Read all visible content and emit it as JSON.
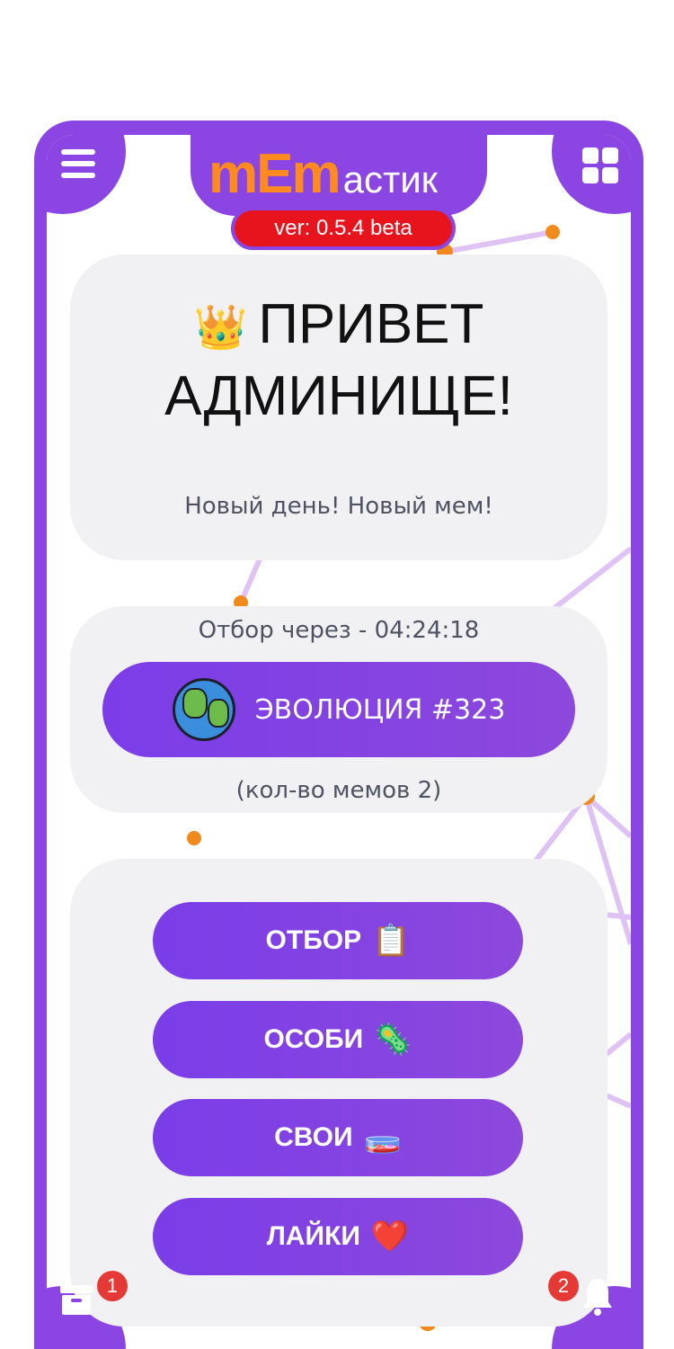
{
  "header": {
    "logo_mem": "mEm",
    "logo_rest": "астик",
    "version": "ver: 0.5.4 beta"
  },
  "welcome": {
    "crown_icon": "👑",
    "title_line1": "ПРИВЕТ",
    "title_line2": "АДМИНИЩЕ!",
    "subtitle": "Новый день! Новый мем!"
  },
  "evolution": {
    "timer": "Отбор через - 04:24:18",
    "button_label": "ЭВОЛЮЦИЯ #323",
    "count": "(кол-во мемов 2)"
  },
  "menu": {
    "items": [
      {
        "label": "ОТБОР",
        "emoji": "📋"
      },
      {
        "label": "ОСОБИ",
        "emoji": "🦠"
      },
      {
        "label": "СВОИ",
        "emoji": "🧫"
      },
      {
        "label": "ЛАЙКИ",
        "emoji": "❤️"
      }
    ]
  },
  "footer": {
    "archive_badge": "1",
    "bell_badge": "2"
  },
  "colors": {
    "accent": "#8b45e2",
    "orange": "#ff8a1f",
    "version_bg": "#e8141d",
    "card_bg": "#f1f1f3"
  }
}
